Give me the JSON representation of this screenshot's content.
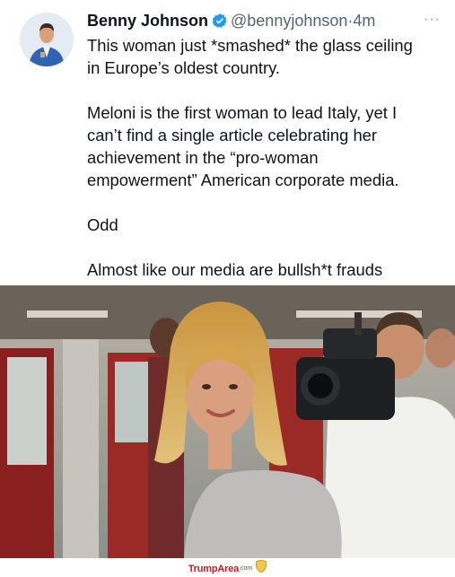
{
  "tweet": {
    "author_name": "Benny Johnson",
    "handle": "@bennyjohnson",
    "separator": "·",
    "time": "4m",
    "more": "···",
    "paragraphs": [
      "This woman just *smashed* the glass ceiling\nin Europe’s oldest country.",
      "Meloni is the first woman to lead Italy, yet I\ncan’t find a single article celebrating her\nachievement in the “pro-woman\nempowerment” American corporate media.",
      "Odd",
      "Almost like our media are bullsh*t frauds"
    ]
  },
  "watermark": {
    "brand": "TrumpArea",
    "suffix": ".com"
  },
  "colors": {
    "verified": "#1d9bf0",
    "text": "#0f1419",
    "muted": "#536471",
    "brand": "#c0201e"
  },
  "icons": [
    "verified-badge-icon",
    "more-icon",
    "shield-icon"
  ]
}
